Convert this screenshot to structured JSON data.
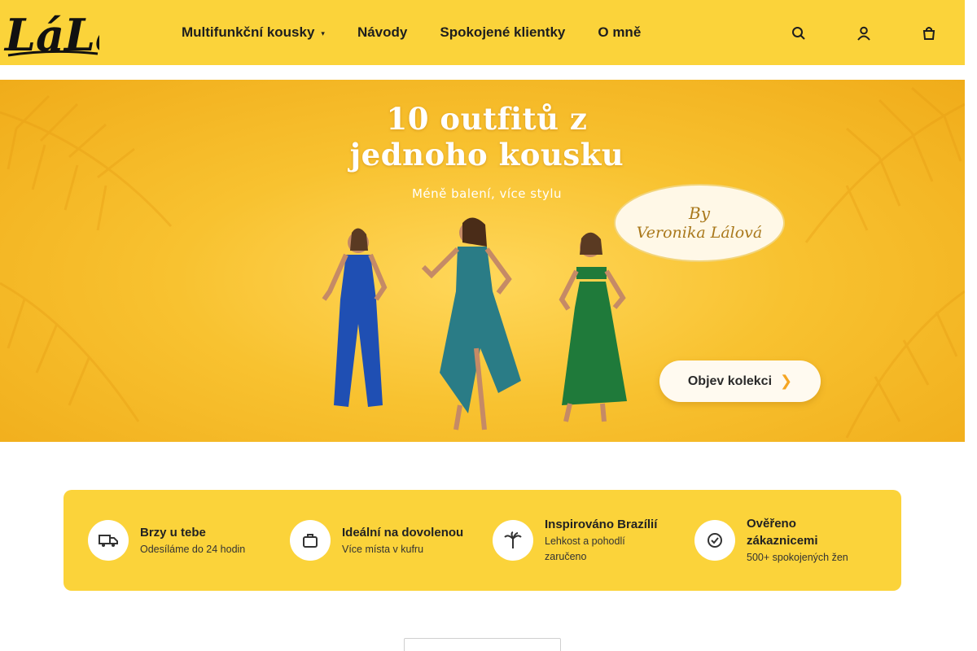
{
  "header": {
    "logo_text": "LáLa",
    "nav": [
      {
        "label": "Multifunkční kousky",
        "has_dropdown": true
      },
      {
        "label": "Návody"
      },
      {
        "label": "Spokojené klientky"
      },
      {
        "label": "O mně"
      }
    ],
    "icons": [
      "search-icon",
      "user-icon",
      "cart-icon"
    ],
    "background_color": "#fbd33a"
  },
  "hero": {
    "title_line1": "10 outfitů z",
    "title_line2": "jednoho kousku",
    "subtitle": "Méně balení, více stylu",
    "badge_line1": "By",
    "badge_line2": "Veronika Lálová",
    "cta_label": "Objev kolekci"
  },
  "features": [
    {
      "icon": "truck-icon",
      "title": "Brzy u tebe",
      "desc": "Odesíláme do 24 hodin"
    },
    {
      "icon": "suitcase-icon",
      "title": "Ideální na dovolenou",
      "desc": "Více místa v kufru"
    },
    {
      "icon": "palm-icon",
      "title": "Inspirováno Brazílií",
      "desc": "Lehkost a pohodlí zaručeno"
    },
    {
      "icon": "badge-check-icon",
      "title": "Ověřeno zákaznicemi",
      "desc": "500+ spokojených žen"
    }
  ]
}
